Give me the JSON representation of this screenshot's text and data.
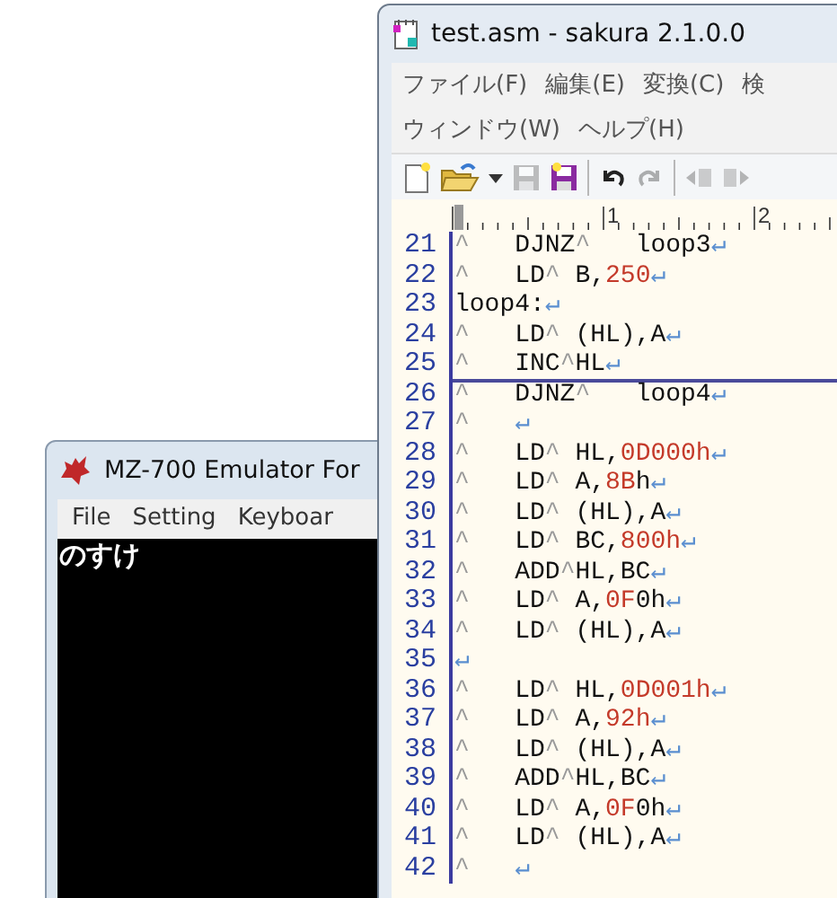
{
  "emulator_window": {
    "title": "MZ-700 Emulator For",
    "menu": [
      "File",
      "Setting",
      "Keyboar"
    ],
    "screen_text": "のすけ"
  },
  "editor_window": {
    "title": "test.asm - sakura 2.1.0.0",
    "menu_rows": [
      [
        "ファイル(F)",
        "編集(E)",
        "変換(C)",
        "検"
      ],
      [
        "ウィンドウ(W)",
        "ヘルプ(H)"
      ]
    ],
    "toolbar": [
      {
        "kind": "new",
        "disabled": false
      },
      {
        "kind": "open",
        "disabled": false
      },
      {
        "kind": "dropdown",
        "disabled": false
      },
      {
        "kind": "save",
        "disabled": true
      },
      {
        "kind": "save_as",
        "disabled": false
      },
      {
        "kind": "separator"
      },
      {
        "kind": "undo",
        "disabled": false
      },
      {
        "kind": "redo",
        "disabled": true
      },
      {
        "kind": "separator"
      },
      {
        "kind": "indent_left",
        "disabled": true
      },
      {
        "kind": "indent_right",
        "disabled": true
      }
    ],
    "ruler_labels": [
      "1",
      "2"
    ],
    "lines": [
      {
        "number": "21",
        "cursor": false,
        "tokens": [
          {
            "kind": "tab",
            "text": "^"
          },
          {
            "kind": "text",
            "text": "DJNZ"
          },
          {
            "kind": "tab",
            "text": "^"
          },
          {
            "kind": "text",
            "text": "loop3"
          },
          {
            "kind": "eol",
            "text": "↵"
          }
        ]
      },
      {
        "number": "22",
        "cursor": false,
        "tokens": [
          {
            "kind": "tab",
            "text": "^"
          },
          {
            "kind": "text",
            "text": "LD"
          },
          {
            "kind": "tab",
            "text": "^"
          },
          {
            "kind": "text",
            "text": "B,"
          },
          {
            "kind": "num",
            "text": "250"
          },
          {
            "kind": "eol",
            "text": "↵"
          }
        ]
      },
      {
        "number": "23",
        "cursor": false,
        "tokens": [
          {
            "kind": "text",
            "text": "loop4:"
          },
          {
            "kind": "eol",
            "text": "↵"
          }
        ]
      },
      {
        "number": "24",
        "cursor": false,
        "tokens": [
          {
            "kind": "tab",
            "text": "^"
          },
          {
            "kind": "text",
            "text": "LD"
          },
          {
            "kind": "tab",
            "text": "^"
          },
          {
            "kind": "text",
            "text": "(HL),A"
          },
          {
            "kind": "eol",
            "text": "↵"
          }
        ]
      },
      {
        "number": "25",
        "cursor": true,
        "tokens": [
          {
            "kind": "tab",
            "text": "^"
          },
          {
            "kind": "text",
            "text": "INC"
          },
          {
            "kind": "tab",
            "text": "^"
          },
          {
            "kind": "text",
            "text": "HL"
          },
          {
            "kind": "eol",
            "text": "↵"
          }
        ]
      },
      {
        "number": "26",
        "cursor": false,
        "tokens": [
          {
            "kind": "tab",
            "text": "^"
          },
          {
            "kind": "text",
            "text": "DJNZ"
          },
          {
            "kind": "tab",
            "text": "^"
          },
          {
            "kind": "text",
            "text": "loop4"
          },
          {
            "kind": "eol",
            "text": "↵"
          }
        ]
      },
      {
        "number": "27",
        "cursor": false,
        "tokens": [
          {
            "kind": "tab",
            "text": "^"
          },
          {
            "kind": "eol",
            "text": "↵"
          }
        ]
      },
      {
        "number": "28",
        "cursor": false,
        "tokens": [
          {
            "kind": "tab",
            "text": "^"
          },
          {
            "kind": "text",
            "text": "LD"
          },
          {
            "kind": "tab",
            "text": "^"
          },
          {
            "kind": "text",
            "text": "HL,"
          },
          {
            "kind": "num",
            "text": "0D000h"
          },
          {
            "kind": "eol",
            "text": "↵"
          }
        ]
      },
      {
        "number": "29",
        "cursor": false,
        "tokens": [
          {
            "kind": "tab",
            "text": "^"
          },
          {
            "kind": "text",
            "text": "LD"
          },
          {
            "kind": "tab",
            "text": "^"
          },
          {
            "kind": "text",
            "text": "A,"
          },
          {
            "kind": "num",
            "text": "8B"
          },
          {
            "kind": "text",
            "text": "h"
          },
          {
            "kind": "eol",
            "text": "↵"
          }
        ]
      },
      {
        "number": "30",
        "cursor": false,
        "tokens": [
          {
            "kind": "tab",
            "text": "^"
          },
          {
            "kind": "text",
            "text": "LD"
          },
          {
            "kind": "tab",
            "text": "^"
          },
          {
            "kind": "text",
            "text": "(HL),A"
          },
          {
            "kind": "eol",
            "text": "↵"
          }
        ]
      },
      {
        "number": "31",
        "cursor": false,
        "tokens": [
          {
            "kind": "tab",
            "text": "^"
          },
          {
            "kind": "text",
            "text": "LD"
          },
          {
            "kind": "tab",
            "text": "^"
          },
          {
            "kind": "text",
            "text": "BC,"
          },
          {
            "kind": "num",
            "text": "800h"
          },
          {
            "kind": "eol",
            "text": "↵"
          }
        ]
      },
      {
        "number": "32",
        "cursor": false,
        "tokens": [
          {
            "kind": "tab",
            "text": "^"
          },
          {
            "kind": "text",
            "text": "ADD"
          },
          {
            "kind": "tab",
            "text": "^"
          },
          {
            "kind": "text",
            "text": "HL,BC"
          },
          {
            "kind": "eol",
            "text": "↵"
          }
        ]
      },
      {
        "number": "33",
        "cursor": false,
        "tokens": [
          {
            "kind": "tab",
            "text": "^"
          },
          {
            "kind": "text",
            "text": "LD"
          },
          {
            "kind": "tab",
            "text": "^"
          },
          {
            "kind": "text",
            "text": "A,"
          },
          {
            "kind": "num",
            "text": "0F"
          },
          {
            "kind": "text",
            "text": "0h"
          },
          {
            "kind": "eol",
            "text": "↵"
          }
        ]
      },
      {
        "number": "34",
        "cursor": false,
        "tokens": [
          {
            "kind": "tab",
            "text": "^"
          },
          {
            "kind": "text",
            "text": "LD"
          },
          {
            "kind": "tab",
            "text": "^"
          },
          {
            "kind": "text",
            "text": "(HL),A"
          },
          {
            "kind": "eol",
            "text": "↵"
          }
        ]
      },
      {
        "number": "35",
        "cursor": false,
        "tokens": [
          {
            "kind": "eol",
            "text": "↵"
          }
        ]
      },
      {
        "number": "36",
        "cursor": false,
        "tokens": [
          {
            "kind": "tab",
            "text": "^"
          },
          {
            "kind": "text",
            "text": "LD"
          },
          {
            "kind": "tab",
            "text": "^"
          },
          {
            "kind": "text",
            "text": "HL,"
          },
          {
            "kind": "num",
            "text": "0D001h"
          },
          {
            "kind": "eol",
            "text": "↵"
          }
        ]
      },
      {
        "number": "37",
        "cursor": false,
        "tokens": [
          {
            "kind": "tab",
            "text": "^"
          },
          {
            "kind": "text",
            "text": "LD"
          },
          {
            "kind": "tab",
            "text": "^"
          },
          {
            "kind": "text",
            "text": "A,"
          },
          {
            "kind": "num",
            "text": "92h"
          },
          {
            "kind": "eol",
            "text": "↵"
          }
        ]
      },
      {
        "number": "38",
        "cursor": false,
        "tokens": [
          {
            "kind": "tab",
            "text": "^"
          },
          {
            "kind": "text",
            "text": "LD"
          },
          {
            "kind": "tab",
            "text": "^"
          },
          {
            "kind": "text",
            "text": "(HL),A"
          },
          {
            "kind": "eol",
            "text": "↵"
          }
        ]
      },
      {
        "number": "39",
        "cursor": false,
        "tokens": [
          {
            "kind": "tab",
            "text": "^"
          },
          {
            "kind": "text",
            "text": "ADD"
          },
          {
            "kind": "tab",
            "text": "^"
          },
          {
            "kind": "text",
            "text": "HL,BC"
          },
          {
            "kind": "eol",
            "text": "↵"
          }
        ]
      },
      {
        "number": "40",
        "cursor": false,
        "tokens": [
          {
            "kind": "tab",
            "text": "^"
          },
          {
            "kind": "text",
            "text": "LD"
          },
          {
            "kind": "tab",
            "text": "^"
          },
          {
            "kind": "text",
            "text": "A,"
          },
          {
            "kind": "num",
            "text": "0F"
          },
          {
            "kind": "text",
            "text": "0h"
          },
          {
            "kind": "eol",
            "text": "↵"
          }
        ]
      },
      {
        "number": "41",
        "cursor": false,
        "tokens": [
          {
            "kind": "tab",
            "text": "^"
          },
          {
            "kind": "text",
            "text": "LD"
          },
          {
            "kind": "tab",
            "text": "^"
          },
          {
            "kind": "text",
            "text": "(HL),A"
          },
          {
            "kind": "eol",
            "text": "↵"
          }
        ]
      },
      {
        "number": "42",
        "cursor": false,
        "tokens": [
          {
            "kind": "tab",
            "text": "^"
          },
          {
            "kind": "eol",
            "text": "↵"
          }
        ]
      }
    ]
  }
}
